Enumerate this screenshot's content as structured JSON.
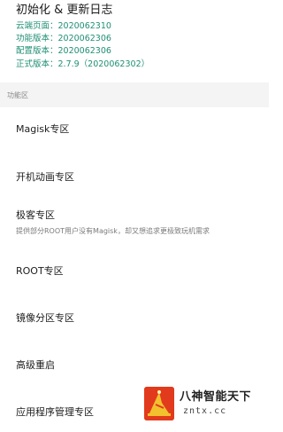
{
  "header": {
    "title": "初始化 & 更新日志",
    "lines": [
      "云端页面：2020062310",
      "功能版本：2020062306",
      "配置版本：2020062306",
      "正式版本：2.7.9（2020062302）"
    ]
  },
  "section": {
    "label": "功能区"
  },
  "items": [
    {
      "title": "Magisk专区"
    },
    {
      "title": "开机动画专区"
    },
    {
      "title": "极客专区",
      "desc": "提供部分ROOT用户没有Magisk，却又想追求更极致玩机需求"
    },
    {
      "title": "ROOT专区"
    },
    {
      "title": "镜像分区专区"
    },
    {
      "title": "高级重启"
    },
    {
      "title": "应用程序管理专区"
    }
  ],
  "watermark": {
    "logo_icon": "wizard-hat-logo-icon",
    "main_text": "八神智能天下",
    "sub_text": "zntx.cc"
  },
  "colors": {
    "info_green": "#1f8f74",
    "section_bg": "#f4f4f4",
    "logo_red": "#e23a1c",
    "logo_gold": "#f2c12e"
  }
}
